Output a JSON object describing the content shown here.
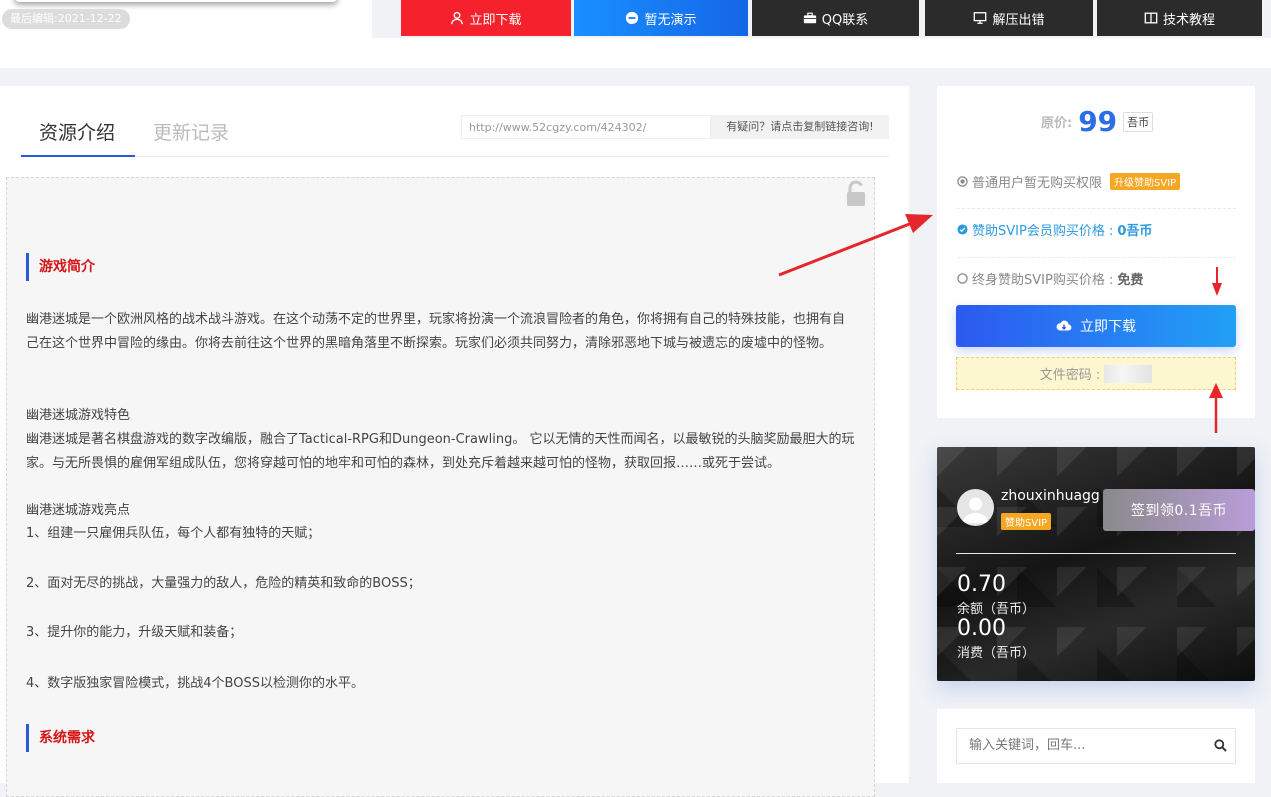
{
  "header": {
    "last_edited": "最后编辑:2021-12-22",
    "buttons": [
      {
        "label": "立即下载",
        "icon": "user-icon",
        "color": "#f5222d"
      },
      {
        "label": "暂无演示",
        "icon": "minus-circle-icon",
        "color": "#1677ff"
      },
      {
        "label": "QQ联系",
        "icon": "briefcase-icon",
        "color": "#2b2b2b"
      },
      {
        "label": "解压出错",
        "icon": "monitor-icon",
        "color": "#2b2b2b"
      },
      {
        "label": "技术教程",
        "icon": "book-icon",
        "color": "#2b2b2b"
      }
    ]
  },
  "tabs": [
    {
      "label": "资源介绍",
      "active": true
    },
    {
      "label": "更新记录",
      "active": false
    }
  ],
  "share": {
    "url": "http://www.52cgzy.com/424302/",
    "button_label": "有疑问？请点击复制链接咨询!"
  },
  "article": {
    "section1_title": "游戏简介",
    "intro": "幽港迷城是一个欧洲风格的战术战斗游戏。在这个动荡不定的世界里，玩家将扮演一个流浪冒险者的角色，你将拥有自己的特殊技能，也拥有自己在这个世界中冒险的缘由。你将去前往这个世界的黑暗角落里不断探索。玩家们必须共同努力，清除邪恶地下城与被遗忘的废墟中的怪物。",
    "features_title": "幽港迷城游戏特色",
    "features": "幽港迷城是著名棋盘游戏的数字改编版，融合了Tactical-RPG和Dungeon-Crawling。 它以无情的天性而闻名，以最敏锐的头脑奖励最胆大的玩家。与无所畏惧的雇佣军组成队伍，您将穿越可怕的地牢和可怕的森林，到处充斥着越来越可怕的怪物，获取回报……或死于尝试。",
    "highlights_title": "幽港迷城游戏亮点",
    "highlights": [
      "1、组建一只雇佣兵队伍，每个人都有独特的天赋；",
      "2、面对无尽的挑战，大量强力的敌人，危险的精英和致命的BOSS；",
      "3、提升你的能力，升级天赋和装备；",
      "4、数字版独家冒险模式，挑战4个BOSS以检测你的水平。"
    ],
    "section2_title": "系统需求"
  },
  "purchase": {
    "price_label": "原价:",
    "price_value": "99",
    "price_unit": "吾币",
    "normal_user": "普通用户暂无购买权限",
    "upgrade_label": "升级赞助SVIP",
    "svip_price_label": "赞助SVIP会员购买价格 : ",
    "svip_price_value": "0吾币",
    "lifetime_label": "终身赞助SVIP购买价格 : ",
    "lifetime_value": "免费",
    "download_label": "立即下载",
    "password_label": "文件密码 :"
  },
  "user": {
    "name": "zhouxinhuagg",
    "badge": "赞助SVIP",
    "sign_label": "签到领0.1吾币",
    "balance_value": "0.70",
    "balance_label": "余额（吾币）",
    "spent_value": "0.00",
    "spent_label": "消费（吾币）"
  },
  "search": {
    "placeholder": "输入关键词，回车..."
  },
  "colors": {
    "accent": "#2a6ee8",
    "annotation": "#e5262a",
    "title_red": "#d51515",
    "vip_orange": "#f5a623"
  }
}
